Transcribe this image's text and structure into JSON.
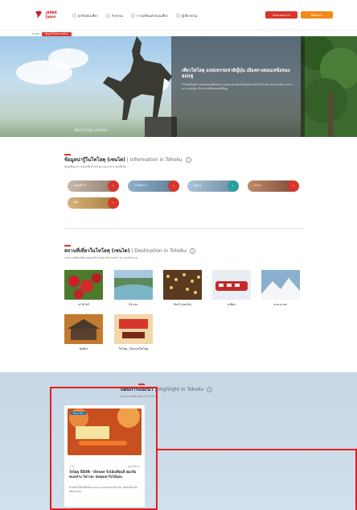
{
  "header": {
    "logo_text_line1": "JAPAN",
    "logo_text_line2": "TRAVEL",
    "logo_brand": "Japan",
    "nav": [
      {
        "label": "ธุรกิจท่องเที่ยว",
        "icon": "circle-icon"
      },
      {
        "label": "กิจกรรม",
        "icon": "circle-icon"
      },
      {
        "label": "การเตรียมตัวก่อนเที่ยว",
        "icon": "circle-icon"
      },
      {
        "label": "ผู้เชี่ยวชาญ",
        "icon": "circle-icon"
      }
    ],
    "search_label": "ค้นหาแผนการ",
    "contact_label": "ติดต่อเรา"
  },
  "breadcrumb": {
    "home": "HOME",
    "current": "ข้อมูลโทโฮคุ (เซนได)"
  },
  "hero": {
    "title": "เที่ยวโทโฮคุ แหล่งธรรมชาติญี่ปุ่น เมืองทางตอนเหนือของฮอนชู",
    "description": "โทโฮคุเป็นภูมิภาคทางตอนเหนือของเกาะฮอนชู ประกอบด้วยจังหวัดอาโอโมริ อิวาเตะ มิยางิ อาคิตะ ยามากาตะ และฟุกุชิมะ มีธรรมชาติที่สวยงามทั้งสี่ฤดู",
    "faded_caption": "เที่ยวโทโฮคุ (เซนได)"
  },
  "info_section": {
    "title_th": "ข้อมูลน่ารู้ในโทโฮคุ (เซนได)",
    "title_en": "| Information in Tohoku",
    "subtitle": "ข้อมูลพื้นฐานการท่องเที่ยวในโทโฮคุ เช่น อาหาร ของขึ้นชื่อ",
    "pills": [
      {
        "label": "ข้อมูลทั่วไป",
        "end_color": "#d7362b"
      },
      {
        "label": "การเดินทาง",
        "end_color": "#d7362b"
      },
      {
        "label": "ฤดูกาล",
        "end_color": "#2a9ea0"
      },
      {
        "label": "อาหาร",
        "end_color": "#d7362b"
      },
      {
        "label": "ที่พัก",
        "end_color": "#d7362b"
      }
    ]
  },
  "dest_section": {
    "title_th": "สถานที่เที่ยวในโทโฮคุ (เซนได)",
    "title_en": "| Destination in Tohoku",
    "subtitle": "รวมสถานที่ท่องเที่ยวยอดนิยมในโทโฮคุ ทั้งธรรมชาติ วัด และเมืองต่างๆ",
    "items": [
      {
        "label": "อาโอโมริ"
      },
      {
        "label": "อิวาเตะ"
      },
      {
        "label": "มิยางิ (เซนได)"
      },
      {
        "label": "อาคิตะ"
      },
      {
        "label": "ยามากาตะ"
      },
      {
        "label": "ฟุกุชิมะ"
      },
      {
        "label": "โทโฮคุ / อินเดอร์โทโฮคุ"
      }
    ]
  },
  "highlight_section": {
    "title_th": "แผนการแนะนำ",
    "title_en": "| Highlight in Tohoku",
    "subtitle": "แผนการท่องเที่ยวที่แนะนำในโทโฮคุ",
    "card": {
      "tag": "New Trip",
      "meta_left": "5 วัน",
      "meta_right": "ฤดูใบไม้ร่วง",
      "title": "โทโฮคุ 5D3N - Oirase ใบไม้เปลี่ยนสี ล่องเรือ ทะเลสาบ โทวาดะ ชมหุบเขาใบไม้แดง",
      "description": "ทัวร์ชมใบไม้เปลี่ยนสี Oirase และทะเลสาบโทวาดะ พร้อมเที่ยวชมเมืองเซนได"
    }
  }
}
